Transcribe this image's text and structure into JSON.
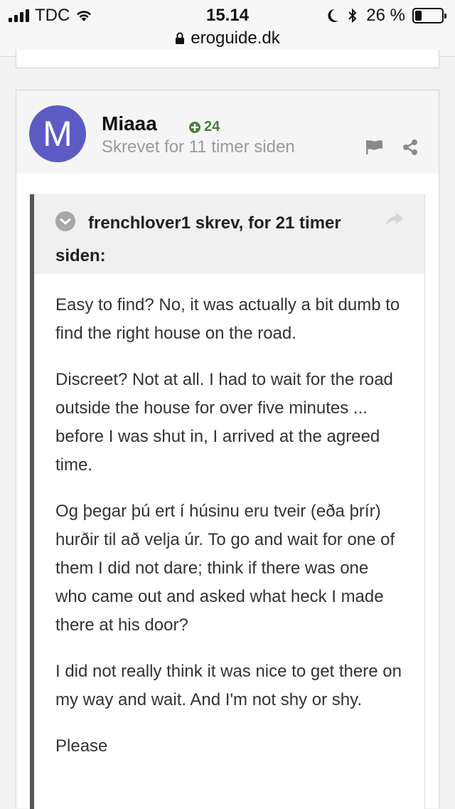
{
  "status_bar": {
    "carrier": "TDC",
    "time": "15.14",
    "battery_percent": "26 %",
    "battery_level": 0.26,
    "url": "eroguide.dk"
  },
  "post": {
    "avatar_letter": "M",
    "avatar_color": "#5c5bc4",
    "author": "Miaaa",
    "reputation": "24",
    "timestamp": "Skrevet for 11 timer siden",
    "quote": {
      "citation": "frenchlover1 skrev, for 21 timer siden:",
      "paragraphs": [
        "Easy to find? No, it was actually a bit dumb to find the right house on the road.",
        "Discreet? Not at all. I had to wait for the road outside the house for over five minutes ... before I was shut in, I arrived at the agreed time.",
        "Og þegar þú ert í húsinu eru tveir (eða þrír) hurðir til að velja úr. To go and wait for one of them I did not dare; think if there was one who came out and asked what heck I made there at his door?",
        "I did not really think it was nice to get there on my way and wait. And I'm not shy or shy.",
        "Please"
      ]
    }
  },
  "icons": {
    "rep": "plus-circle-icon",
    "report": "flag-icon",
    "share": "share-icon",
    "quote_toggle": "chevron-down-icon",
    "quote_goto": "reply-arrow-icon"
  }
}
